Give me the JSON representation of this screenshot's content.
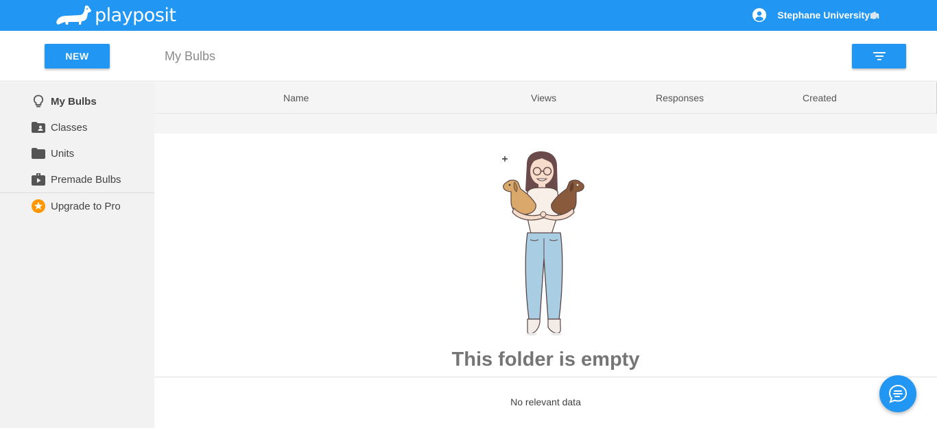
{
  "brand": {
    "name": "playposit"
  },
  "user": {
    "name": "Stephane Universityrh"
  },
  "toolbar": {
    "new_label": "NEW",
    "page_title": "My Bulbs"
  },
  "sidebar": {
    "items": [
      {
        "label": "My Bulbs",
        "icon": "lightbulb-icon",
        "active": true
      },
      {
        "label": "Classes",
        "icon": "shared-folder-icon"
      },
      {
        "label": "Units",
        "icon": "folder-icon"
      },
      {
        "label": "Premade Bulbs",
        "icon": "briefcase-play-icon"
      },
      {
        "label": "Upgrade to Pro",
        "icon": "star-badge-icon"
      }
    ]
  },
  "table": {
    "columns": [
      "Name",
      "Views",
      "Responses",
      "Created"
    ]
  },
  "empty_state": {
    "title": "This folder is empty",
    "message": "No relevant data"
  },
  "colors": {
    "primary": "#2196f3",
    "sidebar_bg": "#f2f2f2",
    "upgrade_star": "#ff9800"
  }
}
